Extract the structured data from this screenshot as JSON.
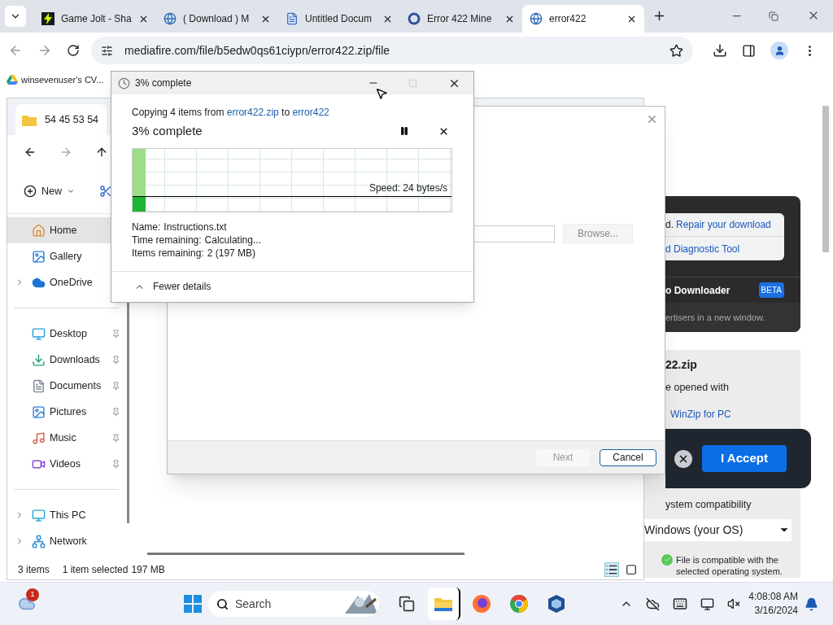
{
  "browser": {
    "tabs": [
      {
        "title": "Game Jolt - Sha",
        "kind": "gamejolt",
        "selected": false
      },
      {
        "title": "( Download ) M",
        "kind": "globe",
        "selected": false
      },
      {
        "title": "Untitled Docum",
        "kind": "doc",
        "selected": false
      },
      {
        "title": "Error 422 Mine",
        "kind": "ring",
        "selected": false
      },
      {
        "title": "error422",
        "kind": "globe",
        "selected": true
      }
    ],
    "address": "mediafire.com/file/b5edw0qs61ciypn/error422.zip/file",
    "bookmark": "winsevenuser's CV..."
  },
  "webpage": {
    "repair_prefix": "d.",
    "repair_link": "Repair your download",
    "diagnostic_link": "d Diagnostic Tool",
    "downloader": "o Downloader",
    "beta": "BETA",
    "ad_note": "ertisers in a new window.",
    "file_name": "22.zip",
    "opened_with": "e opened with",
    "winzip_link": "WinZip for PC",
    "compat_heading": "ystem compatibility",
    "os_select": "Windows (your OS)",
    "compat_note": "File is compatible with the selected operating system."
  },
  "cookie_bar": {
    "accept": "I Accept"
  },
  "explorer": {
    "tab_title": "54 45 53 54",
    "new_button": "New",
    "sidebar": {
      "groups": [
        [
          {
            "label": "Home",
            "kind": "home",
            "selected": true,
            "pinned": false,
            "expandable": false
          },
          {
            "label": "Gallery",
            "kind": "gallery",
            "selected": false,
            "pinned": false,
            "expandable": false
          },
          {
            "label": "OneDrive",
            "kind": "cloud",
            "selected": false,
            "pinned": false,
            "expandable": true
          }
        ],
        [
          {
            "label": "Desktop",
            "kind": "desktop",
            "selected": false,
            "pinned": true,
            "expandable": false
          },
          {
            "label": "Downloads",
            "kind": "download",
            "selected": false,
            "pinned": true,
            "expandable": false
          },
          {
            "label": "Documents",
            "kind": "document",
            "selected": false,
            "pinned": true,
            "expandable": false
          },
          {
            "label": "Pictures",
            "kind": "gallery",
            "selected": false,
            "pinned": true,
            "expandable": false
          },
          {
            "label": "Music",
            "kind": "music",
            "selected": false,
            "pinned": true,
            "expandable": false
          },
          {
            "label": "Videos",
            "kind": "video",
            "selected": false,
            "pinned": true,
            "expandable": false
          }
        ],
        [
          {
            "label": "This PC",
            "kind": "pc",
            "selected": false,
            "pinned": false,
            "expandable": true
          },
          {
            "label": "Network",
            "kind": "network",
            "selected": false,
            "pinned": false,
            "expandable": true
          }
        ]
      ]
    },
    "status": [
      "3 items",
      "1 item selected",
      "197 MB"
    ]
  },
  "wizard": {
    "browse": "Browse...",
    "next": {
      "label": "Next",
      "disabled": true
    },
    "cancel": {
      "label": "Cancel",
      "disabled": false
    }
  },
  "copy_dialog": {
    "title": "3% complete",
    "copying": "Copying 4 items from ",
    "source": "error422.zip",
    "to": " to ",
    "destination": "error422",
    "heading": "3% complete",
    "level": 0.04,
    "speed": "Speed: 24 bytes/s",
    "details": [
      {
        "label": "Name:",
        "value": "Instructions.txt"
      },
      {
        "label": "Time remaining:",
        "value": "Calculating..."
      },
      {
        "label": "Items remaining:",
        "value": "2 (197 MB)"
      }
    ],
    "fewer_details": "Fewer details"
  },
  "taskbar": {
    "badge": "1",
    "search": "Search",
    "apps": [
      {
        "kind": "taskview",
        "selected": false
      },
      {
        "kind": "explorer",
        "selected": true
      },
      {
        "kind": "firefox",
        "selected": false
      },
      {
        "kind": "chrome",
        "selected": false
      },
      {
        "kind": "cube",
        "selected": false
      }
    ],
    "time": "4:08:08 AM",
    "date": "3/16/2024"
  }
}
